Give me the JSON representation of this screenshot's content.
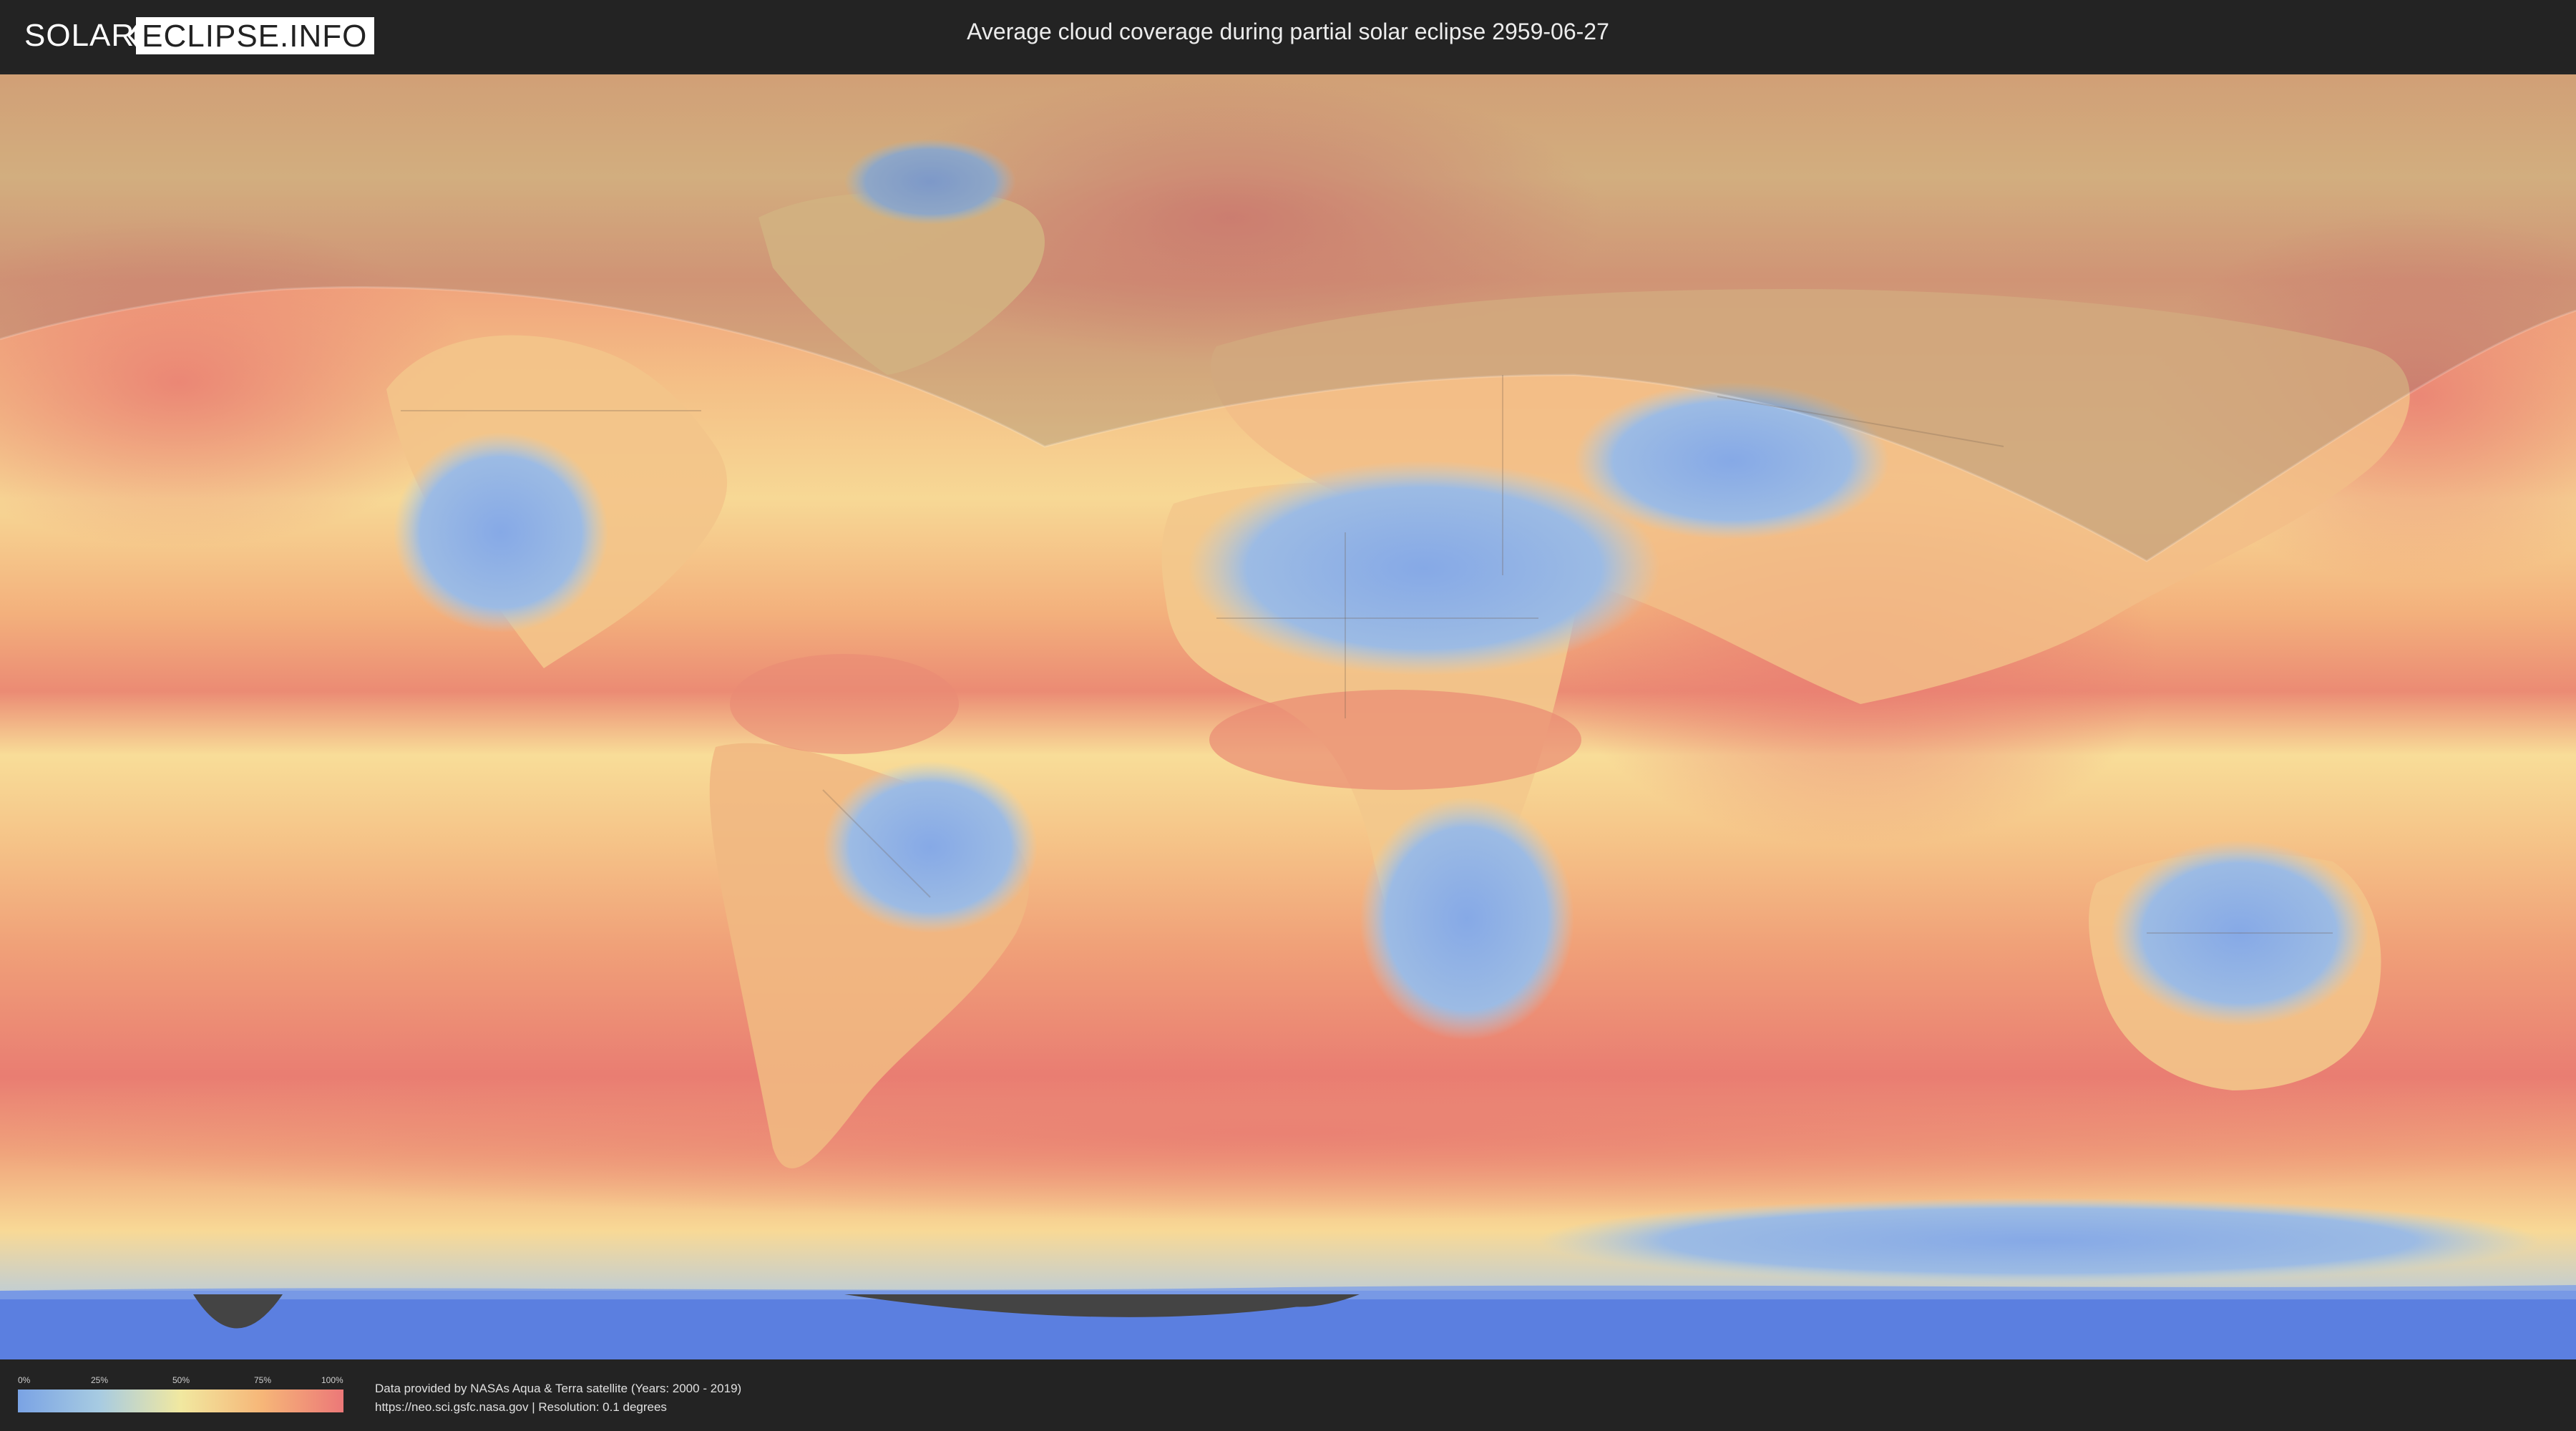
{
  "header": {
    "logo_left": "SOLAR",
    "logo_right": "ECLIPSE.INFO",
    "title": "Average cloud coverage during partial solar eclipse 2959-06-27"
  },
  "legend": {
    "ticks": [
      "0%",
      "25%",
      "50%",
      "75%",
      "100%"
    ],
    "colors": [
      "#7aa3e4",
      "#a7cbe2",
      "#f1e8a0",
      "#f6b678",
      "#ec7878"
    ]
  },
  "footer": {
    "credit_line_1": "Data provided by NASAs Aqua & Terra satellite (Years: 2000 - 2019)",
    "credit_line_2": "https://neo.sci.gsfc.nasa.gov | Resolution: 0.1 degrees"
  },
  "map": {
    "colors": {
      "cloudy": "#e97d72",
      "medium": "#f5c987",
      "clear": "#8fb1e6",
      "polar_ice": "#5b7fe0",
      "eclipse_shade": "#5e5e5e"
    }
  }
}
